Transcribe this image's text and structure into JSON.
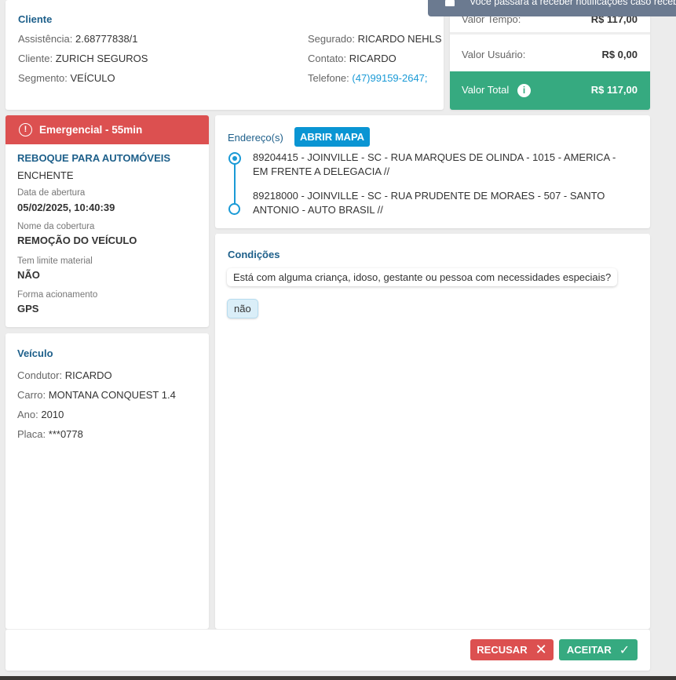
{
  "notification": {
    "text": "Você passará a receber notificações caso receba alguma",
    "icon": "bell-icon"
  },
  "cliente": {
    "title": "Cliente",
    "left": [
      {
        "label": "Assistência:",
        "value": "2.68777838/1"
      },
      {
        "label": "Cliente:",
        "value": "ZURICH SEGUROS"
      },
      {
        "label": "Segmento:",
        "value": "VEÍCULO"
      }
    ],
    "right": [
      {
        "label": "Segurado:",
        "value": "RICARDO NEHLS"
      },
      {
        "label": "Contato:",
        "value": "RICARDO"
      },
      {
        "label": "Telefone:",
        "value": "(47)99159-2647;"
      }
    ]
  },
  "valores": {
    "tempo_label": "Valor Tempo:",
    "tempo_value": "R$ 117,00",
    "usuario_label": "Valor Usuário:",
    "usuario_value": "R$ 0,00",
    "total_label": "Valor Total",
    "total_value": "R$ 117,00"
  },
  "servico": {
    "badge": "Emergencial - 55min",
    "name": "REBOQUE PARA AUTOMÓVEIS",
    "motivo": "ENCHENTE",
    "fields": [
      {
        "label": "Data de abertura",
        "value": "05/02/2025, 10:40:39"
      },
      {
        "label": "Nome da cobertura",
        "value": "REMOÇÃO DO VEÍCULO"
      },
      {
        "label": "Tem limite material",
        "value": "NÃO"
      },
      {
        "label": "Forma acionamento",
        "value": "GPS"
      }
    ]
  },
  "enderecos": {
    "title": "Endereço(s)",
    "map_button": "ABRIR MAPA",
    "items": [
      "89204415 - JOINVILLE - SC - RUA MARQUES DE OLINDA - 1015 - AMERICA - EM FRENTE A DELEGACIA //",
      "89218000 - JOINVILLE - SC - RUA PRUDENTE DE MORAES - 507 - SANTO ANTONIO - AUTO BRASIL //"
    ]
  },
  "condicoes": {
    "title": "Condições",
    "question": "Está com alguma criança, idoso, gestante ou pessoa com necessidades especiais?",
    "answer": "não"
  },
  "veiculo": {
    "title": "Veículo",
    "fields": [
      {
        "label": "Condutor:",
        "value": "RICARDO"
      },
      {
        "label": "Carro:",
        "value": "MONTANA CONQUEST 1.4"
      },
      {
        "label": "Ano:",
        "value": "2010"
      },
      {
        "label": "Placa:",
        "value": "***0778"
      }
    ]
  },
  "actions": {
    "refuse": "RECUSAR",
    "accept": "ACEITAR"
  },
  "colors": {
    "primary": "#1d5f8a",
    "link": "#1a9ad6",
    "danger": "#dc5050",
    "success": "#36aa80",
    "toast": "#6b7a90"
  }
}
